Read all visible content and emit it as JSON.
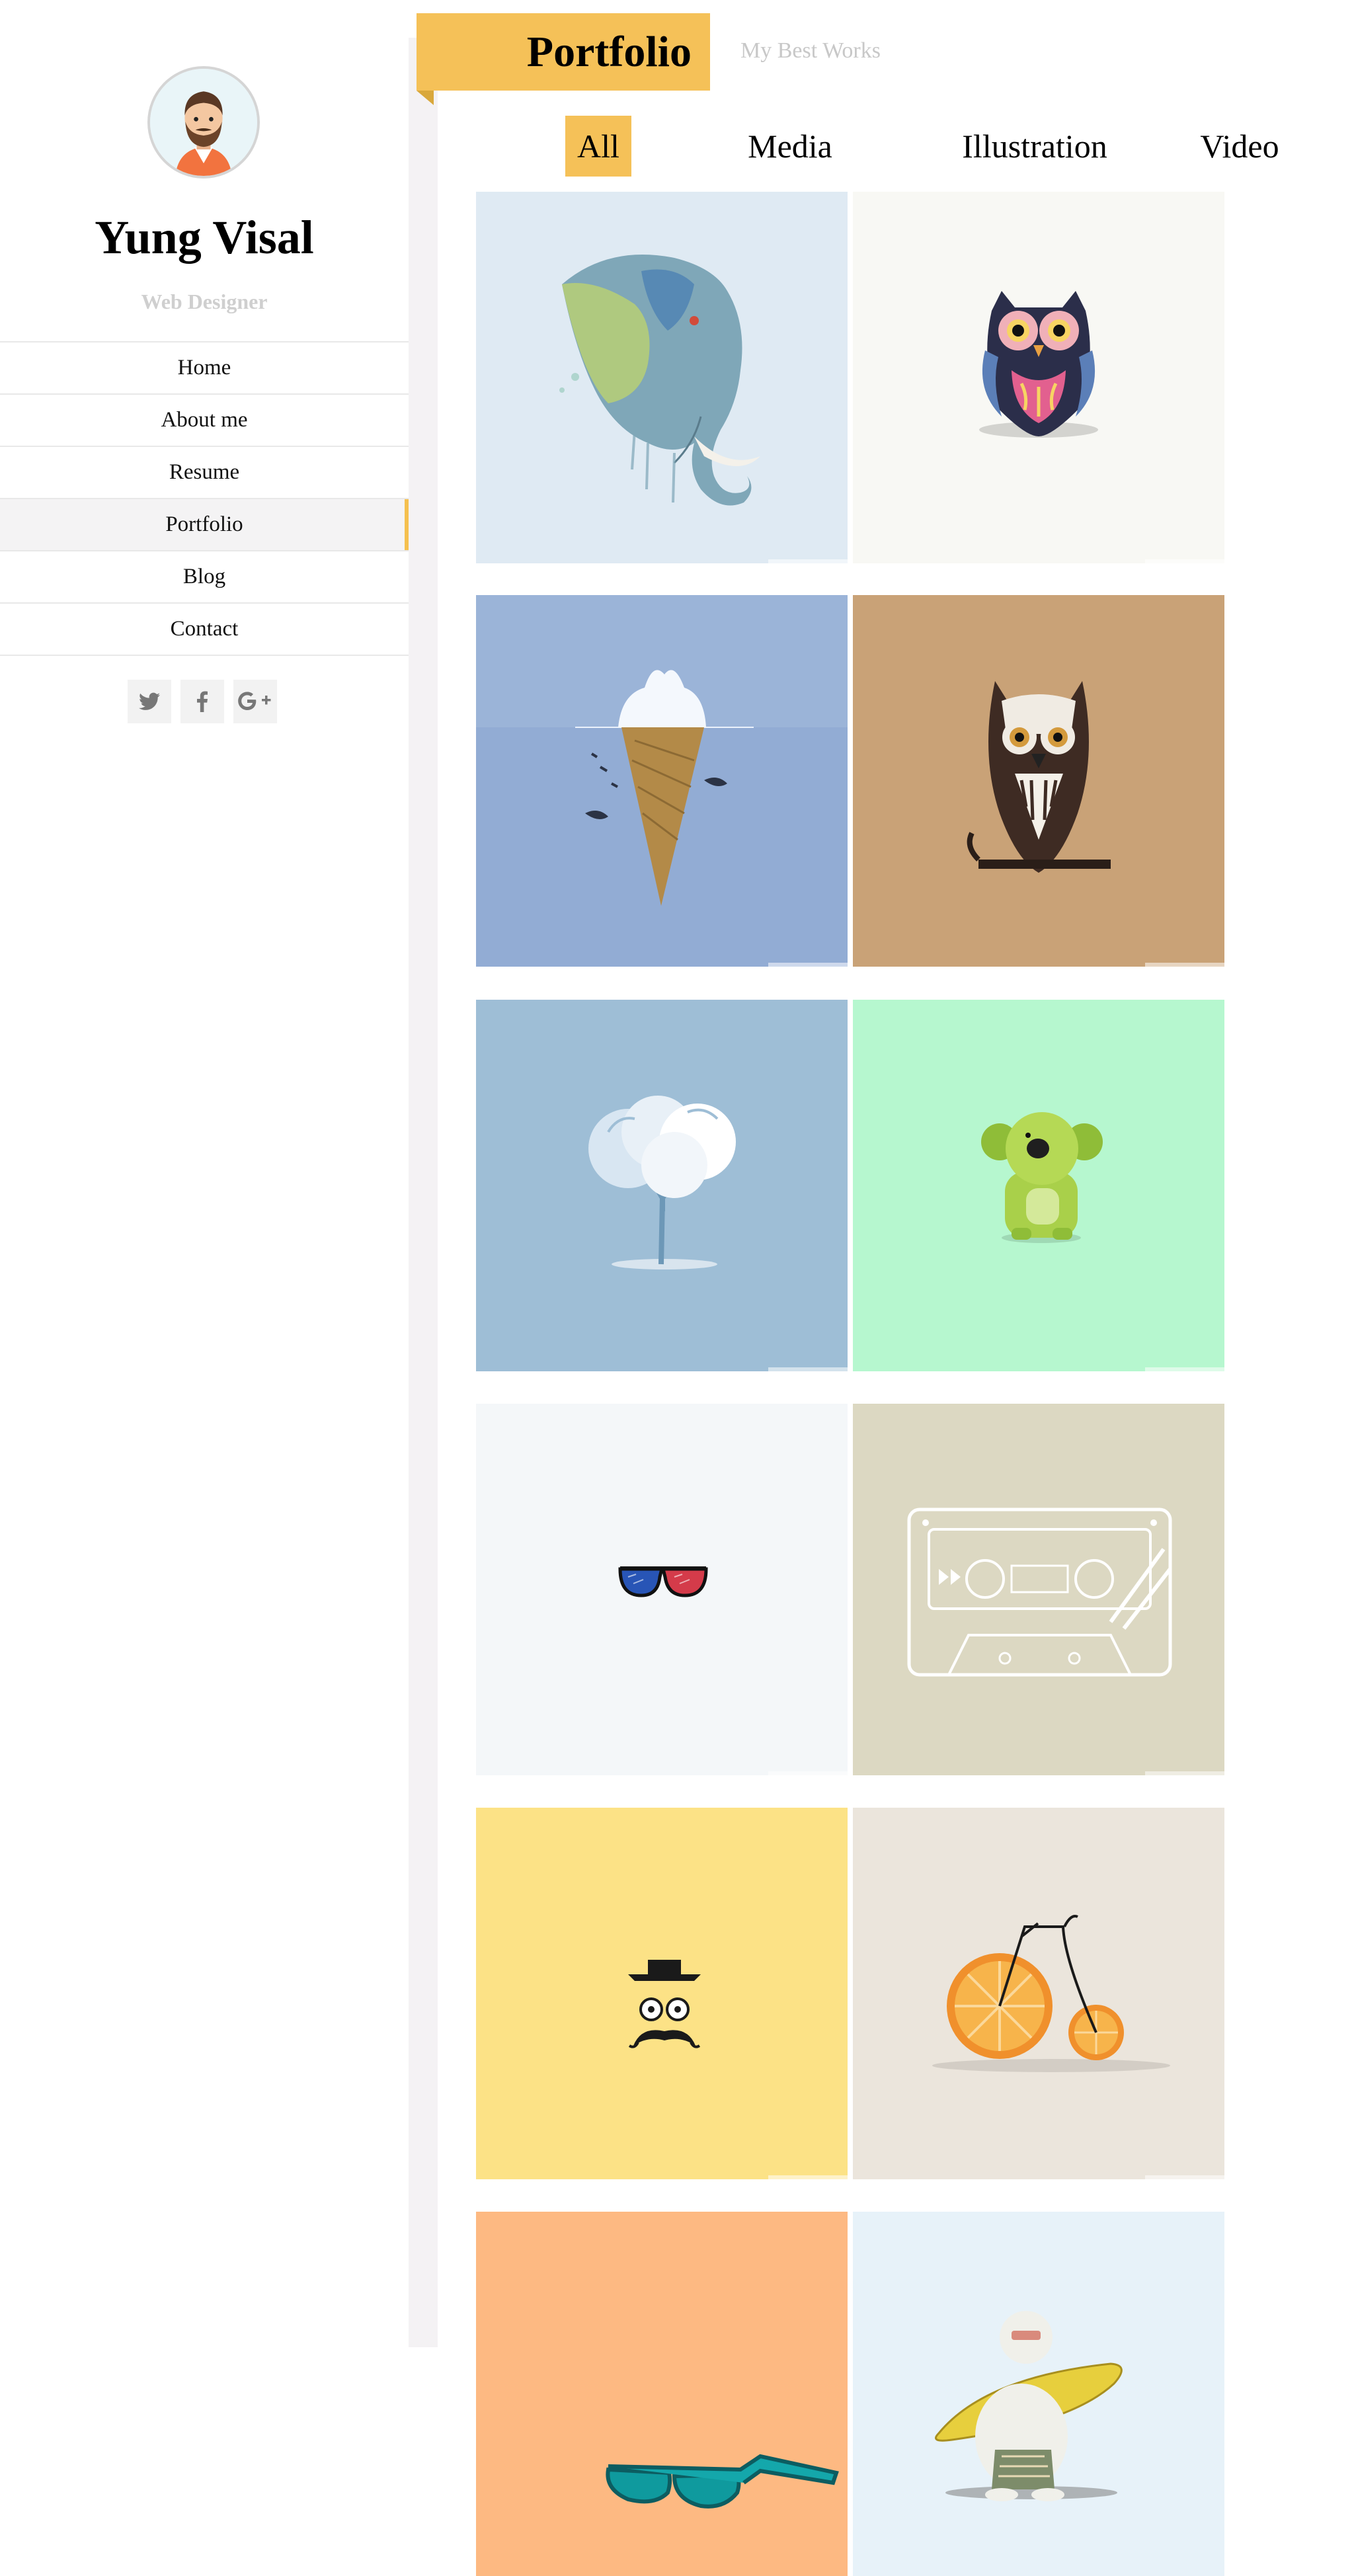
{
  "profile": {
    "name": "Yung Visal",
    "role": "Web Designer"
  },
  "nav": {
    "items": [
      "Home",
      "About me",
      "Resume",
      "Portfolio",
      "Blog",
      "Contact"
    ],
    "active": "Portfolio"
  },
  "socials": [
    "twitter-icon",
    "facebook-icon",
    "google-plus-icon"
  ],
  "header": {
    "title": "Portfolio",
    "subtitle": "My Best Works"
  },
  "filters": {
    "items": [
      "All",
      "Media",
      "Illustration",
      "Video"
    ],
    "active": "All"
  },
  "colors": {
    "accent": "#f5c158",
    "rail": "#f4f2f4",
    "muted_text": "#c8c8c8"
  },
  "gallery": [
    {
      "subject": "elephant-illustration",
      "bg": "#dfeaf3"
    },
    {
      "subject": "pink-owl-illustration",
      "bg": "#f8f8f4"
    },
    {
      "subject": "iceberg-ice-cream-illustration",
      "bg": "#9bb4d8"
    },
    {
      "subject": "brown-owl-illustration",
      "bg": "#c9a277"
    },
    {
      "subject": "cloud-tree-illustration",
      "bg": "#9ebed6"
    },
    {
      "subject": "green-koala-illustration",
      "bg": "#b6f7cf"
    },
    {
      "subject": "3d-glasses-illustration",
      "bg": "#f4f7f9"
    },
    {
      "subject": "cassette-tape-illustration",
      "bg": "#dcd8c2"
    },
    {
      "subject": "mustache-gentleman-illustration",
      "bg": "#fce286"
    },
    {
      "subject": "orange-bicycle-illustration",
      "bg": "#ebe5dc"
    },
    {
      "subject": "teal-sunglasses-illustration",
      "bg": "#fdb982"
    },
    {
      "subject": "surfer-illustration",
      "bg": "#e7f2f9"
    }
  ]
}
